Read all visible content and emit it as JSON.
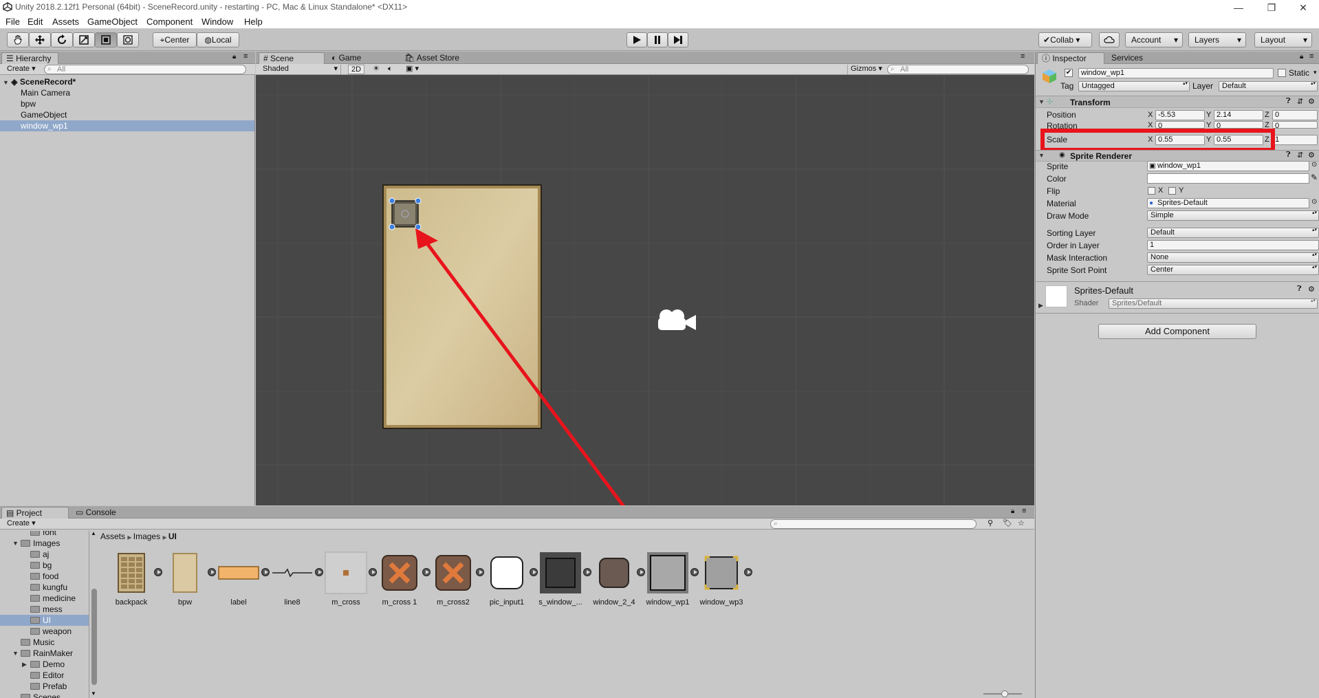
{
  "window": {
    "title": "Unity 2018.2.12f1 Personal (64bit) - SceneRecord.unity - restarting - PC, Mac & Linux Standalone* <DX11>",
    "minimize": "—",
    "restore": "❐",
    "close": "✕"
  },
  "menu": [
    "File",
    "Edit",
    "Assets",
    "GameObject",
    "Component",
    "Window",
    "Help"
  ],
  "toolbar": {
    "pivot": "Center",
    "space": "Local",
    "collab": "Collab",
    "account": "Account",
    "layers": "Layers",
    "layout": "Layout"
  },
  "hierarchy": {
    "tab": "Hierarchy",
    "create": "Create",
    "search_placeholder": "All",
    "scene": "SceneRecord*",
    "items": [
      "Main Camera",
      "bpw",
      "GameObject",
      "window_wp1"
    ],
    "selected_index": 3
  },
  "scene_view": {
    "tabs": [
      "Scene",
      "Game",
      "Asset Store"
    ],
    "shading": "Shaded",
    "mode_2d": "2D",
    "gizmos": "Gizmos",
    "search_placeholder": "All"
  },
  "inspector": {
    "tabs": [
      "Inspector",
      "Services"
    ],
    "object_name": "window_wp1",
    "static_label": "Static",
    "tag_label": "Tag",
    "tag_value": "Untagged",
    "layer_label": "Layer",
    "layer_value": "Default",
    "transform": {
      "title": "Transform",
      "position_label": "Position",
      "rotation_label": "Rotation",
      "scale_label": "Scale",
      "position": {
        "x": "-5.53",
        "y": "2.14",
        "z": "0"
      },
      "rotation": {
        "x": "0",
        "y": "0",
        "z": "0"
      },
      "scale": {
        "x": "0.55",
        "y": "0.55",
        "z": "1"
      }
    },
    "sprite_renderer": {
      "title": "Sprite Renderer",
      "sprite_label": "Sprite",
      "sprite_value": "window_wp1",
      "color_label": "Color",
      "flip_label": "Flip",
      "flip_x": "X",
      "flip_y": "Y",
      "material_label": "Material",
      "material_value": "Sprites-Default",
      "draw_mode_label": "Draw Mode",
      "draw_mode_value": "Simple",
      "sorting_layer_label": "Sorting Layer",
      "sorting_layer_value": "Default",
      "order_label": "Order in Layer",
      "order_value": "1",
      "mask_label": "Mask Interaction",
      "mask_value": "None",
      "sort_point_label": "Sprite Sort Point",
      "sort_point_value": "Center"
    },
    "material": {
      "name": "Sprites-Default",
      "shader_label": "Shader",
      "shader_value": "Sprites/Default"
    },
    "add_component": "Add Component"
  },
  "project": {
    "tabs": [
      "Project",
      "Console"
    ],
    "create": "Create",
    "tree": [
      {
        "label": "font",
        "indent": 2,
        "expanded": null
      },
      {
        "label": "Images",
        "indent": 1,
        "expanded": true
      },
      {
        "label": "aj",
        "indent": 2,
        "expanded": null
      },
      {
        "label": "bg",
        "indent": 2,
        "expanded": null
      },
      {
        "label": "food",
        "indent": 2,
        "expanded": null
      },
      {
        "label": "kungfu",
        "indent": 2,
        "expanded": null
      },
      {
        "label": "medicine",
        "indent": 2,
        "expanded": null
      },
      {
        "label": "mess",
        "indent": 2,
        "expanded": null
      },
      {
        "label": "UI",
        "indent": 2,
        "expanded": null
      },
      {
        "label": "weapon",
        "indent": 2,
        "expanded": null
      },
      {
        "label": "Music",
        "indent": 1,
        "expanded": null
      },
      {
        "label": "RainMaker",
        "indent": 1,
        "expanded": true
      },
      {
        "label": "Demo",
        "indent": 2,
        "expanded": false
      },
      {
        "label": "Editor",
        "indent": 2,
        "expanded": null
      },
      {
        "label": "Prefab",
        "indent": 2,
        "expanded": null
      },
      {
        "label": "Scenes",
        "indent": 1,
        "expanded": null
      }
    ],
    "selected_folder": "UI",
    "breadcrumb": [
      "Assets",
      "Images",
      "UI"
    ],
    "assets": [
      {
        "name": "backpack",
        "kind": "backpack"
      },
      {
        "name": "bpw",
        "kind": "parchment"
      },
      {
        "name": "label",
        "kind": "label"
      },
      {
        "name": "line8",
        "kind": "line"
      },
      {
        "name": "m_cross",
        "kind": "dot"
      },
      {
        "name": "m_cross 1",
        "kind": "cross"
      },
      {
        "name": "m_cross2",
        "kind": "cross"
      },
      {
        "name": "pic_input1",
        "kind": "white"
      },
      {
        "name": "s_window_...",
        "kind": "dark"
      },
      {
        "name": "window_2_4",
        "kind": "brown"
      },
      {
        "name": "window_wp1",
        "kind": "gray"
      },
      {
        "name": "window_wp3",
        "kind": "gray-gold"
      }
    ]
  },
  "colors": {
    "highlight_red": "#e8141c",
    "selection": "#8fa7c9",
    "scene_bg": "#464646",
    "parchment": "#d9c9a0"
  }
}
